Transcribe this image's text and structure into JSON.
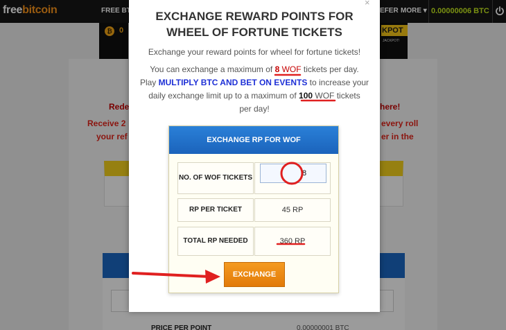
{
  "background": {
    "logo_free": "free",
    "logo_bitcoin": "bitcoin",
    "nav_free": "FREE BTC",
    "nav_refer": "EFER",
    "nav_more": "MORE ▾",
    "balance": "0.00000006 BTC",
    "coin_symbol": "₿",
    "coin_partial": "0",
    "jackpot": "KPOT",
    "jackpot_sub": "JACKPOT!",
    "line1_left": "Rede",
    "line1_right": "here!",
    "line2_left": "Receive 2",
    "line2_right": "every roll",
    "line3_left": "your ref",
    "line3_right": "er in the",
    "price_label": "PRICE PER POINT",
    "price_value": "0.00000001 BTC"
  },
  "modal": {
    "close_label": "×",
    "title_line1": "EXCHANGE REWARD POINTS FOR",
    "title_line2": "WHEEL OF FORTUNE TICKETS",
    "intro": "Exchange your reward points for wheel for fortune tickets!",
    "max_prefix": "You can exchange a maximum of ",
    "max_value": "8",
    "max_wof": "WOF",
    "max_suffix": " tickets per day.",
    "play": "Play ",
    "play_link": "MULTIPLY BTC AND BET ON EVENTS",
    "play_suffix": " to increase your",
    "daily_prefix": "daily exchange limit up to a maximum of ",
    "daily_value": "100",
    "daily_wof": "WOF",
    "daily_suffix": " tickets",
    "per_day": "per day!"
  },
  "exchange": {
    "header": "EXCHANGE RP FOR WOF",
    "wof_label": "NO. OF WOF TICKETS",
    "wof_value": "8",
    "rp_per_ticket_label": "RP PER TICKET",
    "rp_per_ticket_value": "45 RP",
    "total_label": "TOTAL RP NEEDED",
    "total_value": "360 RP",
    "button_label": "EXCHANGE"
  },
  "colors": {
    "header_blue": "#1f6ec8",
    "button_orange": "#f08c17",
    "annotation_red": "#e02020",
    "link_blue": "#1e30d6"
  },
  "icons": [
    "power-icon",
    "bitcoin-coin-icon",
    "close-icon"
  ]
}
